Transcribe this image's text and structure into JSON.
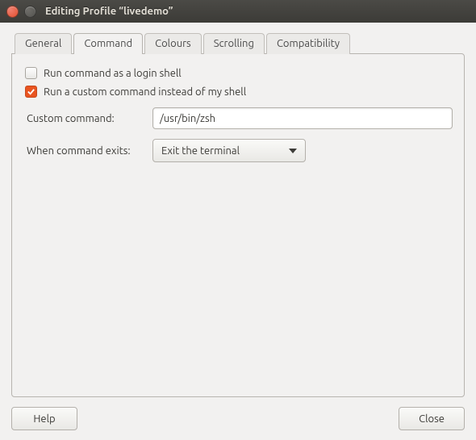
{
  "window": {
    "title": "Editing Profile “livedemo”"
  },
  "tabs": [
    {
      "label": "General"
    },
    {
      "label": "Command"
    },
    {
      "label": "Colours"
    },
    {
      "label": "Scrolling"
    },
    {
      "label": "Compatibility"
    }
  ],
  "active_tab_index": 1,
  "command_panel": {
    "login_shell": {
      "label": "Run command as a login shell",
      "checked": false
    },
    "custom_command_toggle": {
      "label": "Run a custom command instead of my shell",
      "checked": true
    },
    "custom_command": {
      "label": "Custom command:",
      "value": "/usr/bin/zsh"
    },
    "when_exits": {
      "label": "When command exits:",
      "selected": "Exit the terminal"
    }
  },
  "buttons": {
    "help": "Help",
    "close": "Close"
  }
}
